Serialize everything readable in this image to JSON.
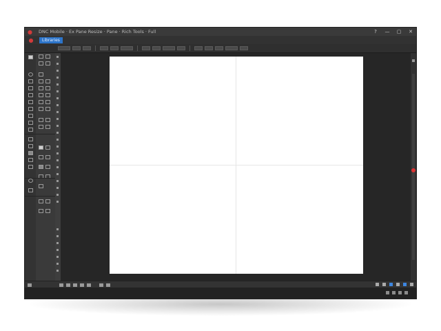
{
  "window": {
    "title": "DNC Mobile · Ex Pane Resize · Pane · Rich Tools · Full",
    "controls": {
      "help": "?",
      "minimize": "—",
      "maximize": "▢",
      "close": "✕"
    }
  },
  "menubar": {
    "active_tab": "Libraries"
  },
  "colors": {
    "accent": "#2c74c9",
    "brand": "#d13a3a",
    "canvas": "#ffffff",
    "workspace": "#262626"
  },
  "icons": {
    "app_logo": "app-logo-icon",
    "marker": "red-dot-icon"
  }
}
